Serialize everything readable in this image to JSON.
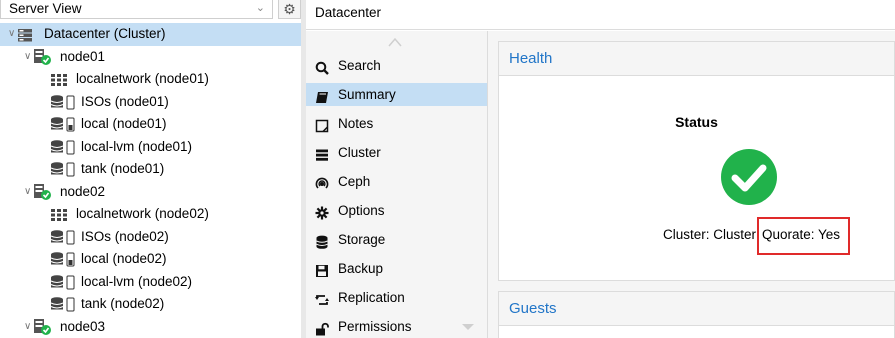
{
  "view_selector": {
    "value": "Server View"
  },
  "breadcrumb": "Datacenter",
  "tree": [
    {
      "label": "Datacenter (Cluster)",
      "type": "datacenter",
      "level": 0,
      "selected": true
    },
    {
      "label": "node01",
      "type": "node",
      "level": 1
    },
    {
      "label": "localnetwork (node01)",
      "type": "network",
      "level": 2
    },
    {
      "label": "ISOs (node01)",
      "type": "storage-iso",
      "level": 2
    },
    {
      "label": "local (node01)",
      "type": "storage-local",
      "level": 2
    },
    {
      "label": "local-lvm (node01)",
      "type": "storage-iso",
      "level": 2
    },
    {
      "label": "tank (node01)",
      "type": "storage-iso",
      "level": 2
    },
    {
      "label": "node02",
      "type": "node",
      "level": 1
    },
    {
      "label": "localnetwork (node02)",
      "type": "network",
      "level": 2
    },
    {
      "label": "ISOs (node02)",
      "type": "storage-iso",
      "level": 2
    },
    {
      "label": "local (node02)",
      "type": "storage-local",
      "level": 2
    },
    {
      "label": "local-lvm (node02)",
      "type": "storage-iso",
      "level": 2
    },
    {
      "label": "tank (node02)",
      "type": "storage-iso",
      "level": 2
    },
    {
      "label": "node03",
      "type": "node",
      "level": 1
    }
  ],
  "nav": [
    {
      "label": "Search",
      "icon": "search-icon"
    },
    {
      "label": "Summary",
      "icon": "book-icon",
      "active": true
    },
    {
      "label": "Notes",
      "icon": "notes-icon"
    },
    {
      "label": "Cluster",
      "icon": "cluster-icon"
    },
    {
      "label": "Ceph",
      "icon": "ceph-icon"
    },
    {
      "label": "Options",
      "icon": "gear-icon"
    },
    {
      "label": "Storage",
      "icon": "database-icon"
    },
    {
      "label": "Backup",
      "icon": "floppy-icon"
    },
    {
      "label": "Replication",
      "icon": "retweet-icon"
    },
    {
      "label": "Permissions",
      "icon": "unlock-icon"
    }
  ],
  "health": {
    "title": "Health",
    "status_label": "Status",
    "status_text": "Cluster: Cluster",
    "quorate_text": "Quorate: Yes"
  },
  "guests": {
    "title": "Guests"
  },
  "colors": {
    "accent": "#2276c8",
    "ok": "#21b24b",
    "highlight": "#e02a2a",
    "selected": "#c4def4"
  }
}
